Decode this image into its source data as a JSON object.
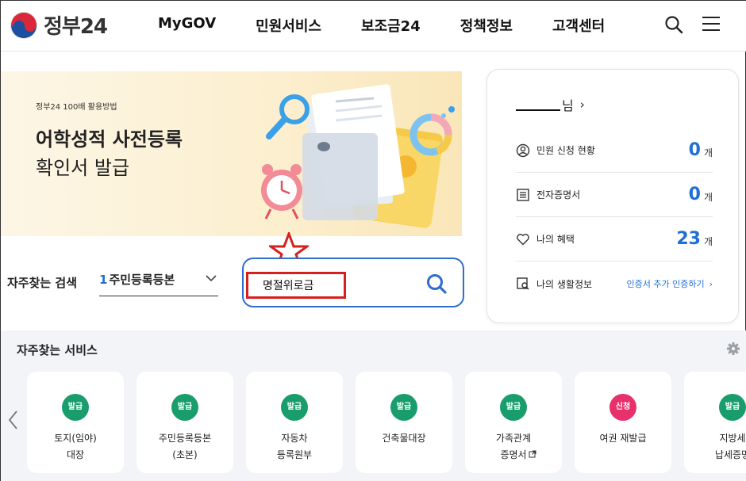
{
  "header": {
    "logo_text": "정부24",
    "nav": [
      "MyGOV",
      "민원서비스",
      "보조금24",
      "정책정보",
      "고객센터"
    ]
  },
  "banner": {
    "subtitle": "정부24 100배 활용방법",
    "title_line1": "어학성적 사전등록",
    "title_line2": "확인서 발급"
  },
  "search": {
    "label": "자주찾는 검색",
    "rank": "1",
    "top_keyword": "주민등록등본",
    "input_value": "명절위로금"
  },
  "user_card": {
    "name_suffix": "님",
    "rows": [
      {
        "icon": "user-circle-icon",
        "label": "민원 신청 현황",
        "count": "0",
        "unit": "개"
      },
      {
        "icon": "document-icon",
        "label": "전자증명서",
        "count": "0",
        "unit": "개"
      },
      {
        "icon": "heart-icon",
        "label": "나의 혜택",
        "count": "23",
        "unit": "개"
      },
      {
        "icon": "magnifier-doc-icon",
        "label": "나의 생활정보",
        "link": "인증서 추가 인증하기"
      }
    ]
  },
  "services": {
    "title": "자주찾는 서비스",
    "items": [
      {
        "badge": "발급",
        "name": "토지(임야)\n대장"
      },
      {
        "badge": "발급",
        "name": "주민등록등본\n(초본)"
      },
      {
        "badge": "발급",
        "name": "자동차\n등록원부"
      },
      {
        "badge": "발급",
        "name": "건축물대장"
      },
      {
        "badge": "발급",
        "name": "가족관계\n증명서"
      },
      {
        "badge": "신청",
        "name": "여권 재발급"
      },
      {
        "badge": "발급",
        "name": "지방세\n납세증명"
      }
    ]
  },
  "colors": {
    "accent": "#1f6fd6",
    "badge_green": "#1a9d6c",
    "badge_pink": "#e8306a",
    "annotation_red": "#d61f1f"
  }
}
